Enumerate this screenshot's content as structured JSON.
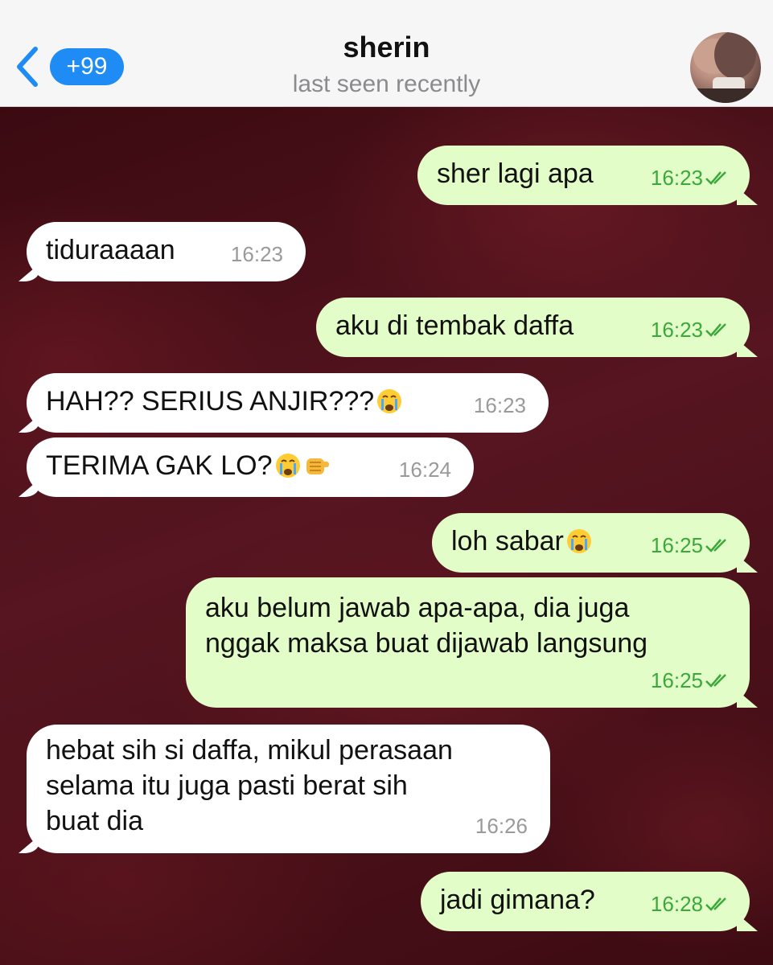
{
  "header": {
    "back_badge": "+99",
    "contact_name": "sherin",
    "status": "last seen recently"
  },
  "messages": [
    {
      "dir": "out",
      "text": "sher lagi apa",
      "time": "16:23"
    },
    {
      "dir": "in",
      "text": "tiduraaaan",
      "time": "16:23"
    },
    {
      "dir": "out",
      "text": "aku di tembak daffa",
      "time": "16:23"
    },
    {
      "dir": "in",
      "text": "HAH?? SERIUS ANJIR???",
      "time": "16:23",
      "emoji": [
        "crying-face"
      ]
    },
    {
      "dir": "in",
      "text": "TERIMA GAK LO?",
      "time": "16:24",
      "emoji": [
        "crying-face",
        "pointing-fist"
      ]
    },
    {
      "dir": "out",
      "text": "loh sabar",
      "time": "16:25",
      "emoji": [
        "crying-face"
      ]
    },
    {
      "dir": "out",
      "line1": "aku belum jawab apa-apa, dia juga",
      "line2": "nggak maksa buat dijawab langsung",
      "time": "16:25"
    },
    {
      "dir": "in",
      "line1": "hebat sih si daffa, mikul perasaan",
      "line2": "selama itu juga pasti berat sih",
      "line3": "buat dia",
      "time": "16:26"
    },
    {
      "dir": "out",
      "text": "jadi gimana?",
      "time": "16:28"
    }
  ],
  "colors": {
    "incoming": "#ffffff",
    "outgoing": "#e3fdc9",
    "outgoing_time": "#3aa83a",
    "badge": "#1f8cf5"
  }
}
